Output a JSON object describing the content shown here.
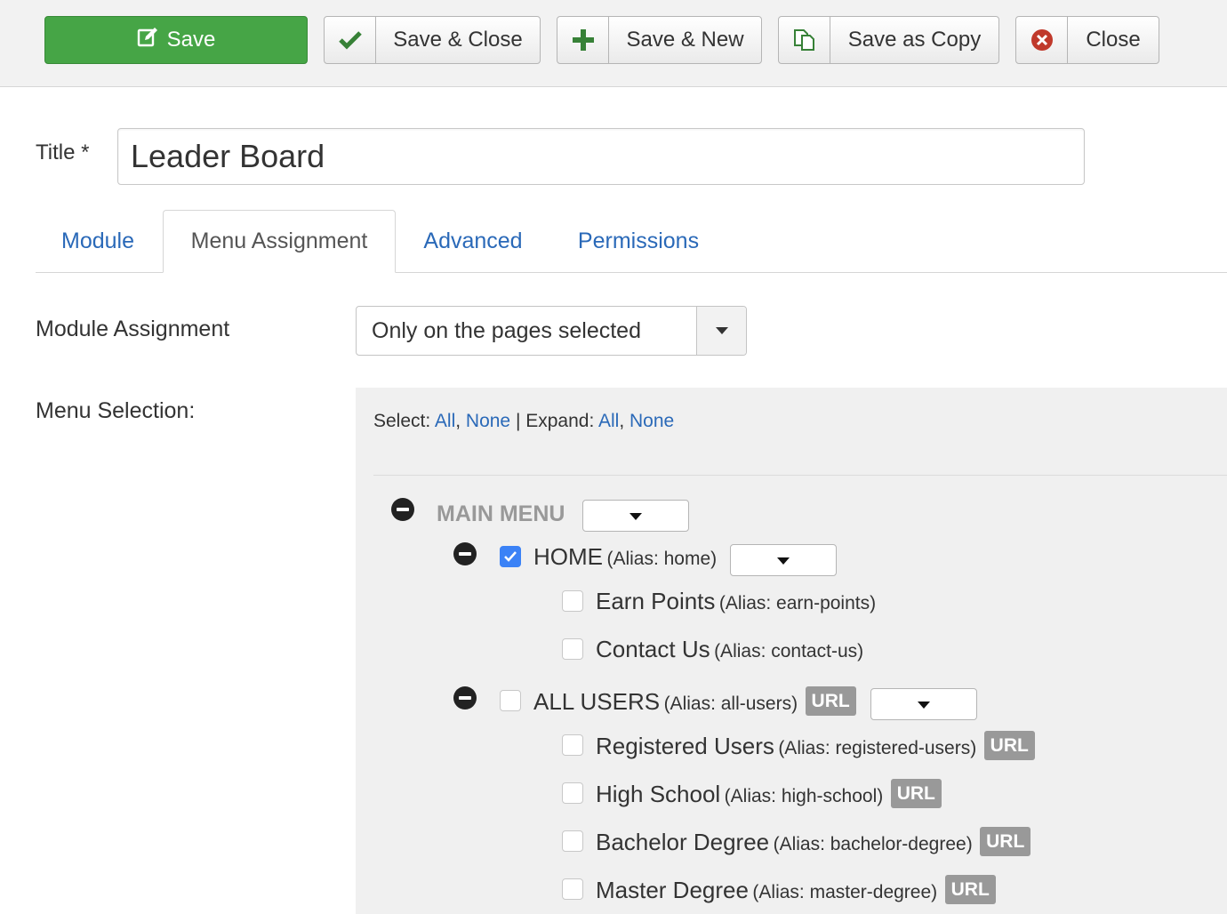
{
  "toolbar": {
    "save_label": "Save",
    "save_close_label": "Save & Close",
    "save_new_label": "Save & New",
    "save_copy_label": "Save as Copy",
    "close_label": "Close"
  },
  "form": {
    "title_label": "Title *",
    "title_value": "Leader Board"
  },
  "tabs": [
    {
      "label": "Module",
      "active": false
    },
    {
      "label": "Menu Assignment",
      "active": true
    },
    {
      "label": "Advanced",
      "active": false
    },
    {
      "label": "Permissions",
      "active": false
    }
  ],
  "assignment": {
    "label": "Module Assignment",
    "selected": "Only on the pages selected"
  },
  "menu_selection": {
    "label": "Menu Selection:",
    "select_label": "Select:",
    "expand_label": "Expand:",
    "all": "All",
    "none": "None",
    "menu_name": "MAIN MENU",
    "items": [
      {
        "name": "HOME",
        "alias": "(Alias: home)",
        "checked": true
      },
      {
        "name": "Earn Points",
        "alias": "(Alias: earn-points)",
        "checked": false
      },
      {
        "name": "Contact Us",
        "alias": "(Alias: contact-us)",
        "checked": false
      },
      {
        "name": "ALL USERS",
        "alias": "(Alias: all-users)",
        "badge": "URL",
        "checked": false
      },
      {
        "name": "Registered Users",
        "alias": "(Alias: registered-users)",
        "badge": "URL",
        "checked": false
      },
      {
        "name": "High School",
        "alias": "(Alias: high-school)",
        "badge": "URL",
        "checked": false
      },
      {
        "name": "Bachelor Degree",
        "alias": "(Alias: bachelor-degree)",
        "badge": "URL",
        "checked": false
      },
      {
        "name": "Master Degree",
        "alias": "(Alias: master-degree)",
        "badge": "URL",
        "checked": false
      }
    ]
  },
  "colors": {
    "save_button": "#46a546",
    "link": "#2a69b8",
    "checkbox_checked": "#3b82f6",
    "badge": "#999999",
    "close_icon": "#c0392b"
  }
}
